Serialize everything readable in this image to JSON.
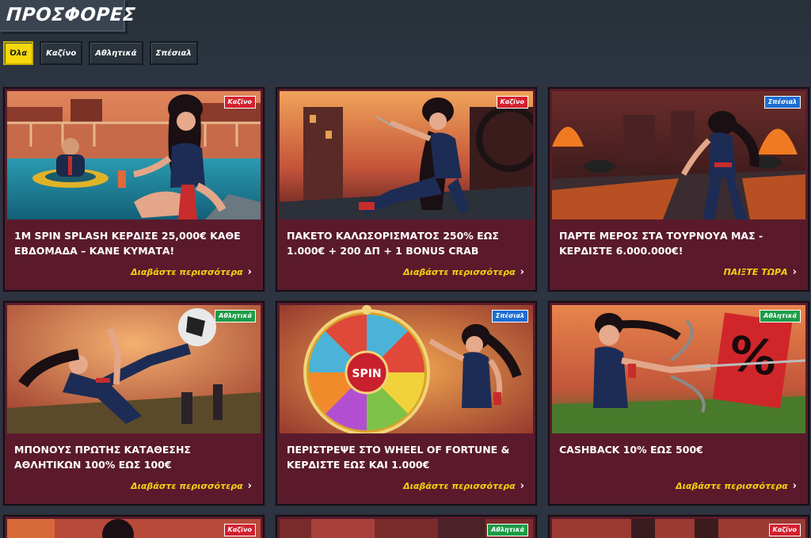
{
  "page": {
    "title": "ΠΡΟΣΦΟΡΕΣ"
  },
  "filters": [
    {
      "label": "Όλα",
      "active": true
    },
    {
      "label": "Καζίνο",
      "active": false
    },
    {
      "label": "Αθλητικά",
      "active": false
    },
    {
      "label": "Σπέσιαλ",
      "active": false
    }
  ],
  "cards": [
    {
      "badge": "Καζίνο",
      "badge_type": "casino",
      "title": "1M SPIN SPLASH ΚΕΡΔΙΣΕ 25,000€ ΚΑΘΕ ΕΒΔΟΜΑΔΑ – ΚΑΝΕ ΚΥΜΑΤΑ!",
      "cta": "Διαβάστε περισσότερα",
      "scene": "pool"
    },
    {
      "badge": "Καζίνο",
      "badge_type": "casino",
      "title": "ΠΑΚΕΤΟ ΚΑΛΩΣΟΡΙΣΜΑΤΟΣ 250% ΕΩΣ 1.000€ + 200 ΔΠ + 1 BONUS CRAB",
      "cta": "Διαβάστε περισσότερα",
      "scene": "roof"
    },
    {
      "badge": "Σπέσιαλ",
      "badge_type": "special",
      "title": "ΠΑΡΤΕ ΜΕΡΟΣ ΣΤΑ ΤΟΥΡΝΟΥΑ ΜΑΣ - ΚΕΡΔΙΣΤΕ 6.000.000€!",
      "cta": "ΠΑΙΞΤΕ ΤΩΡΑ",
      "scene": "fire"
    },
    {
      "badge": "Αθλητικά",
      "badge_type": "sports",
      "title": "ΜΠΟΝΟΥΣ ΠΡΩΤΗΣ ΚΑΤΑΘΕΣΗΣ ΑΘΛΗΤΙΚΩΝ 100% ΕΩΣ 100€",
      "cta": "Διαβάστε περισσότερα",
      "scene": "kick"
    },
    {
      "badge": "Σπέσιαλ",
      "badge_type": "special",
      "title": "ΠΕΡΙΣΤΡΕΨΕ ΣΤΟ WHEEL OF FORTUNE & ΚΕΡΔΙΣΤΕ ΕΩΣ ΚΑΙ 1.000€",
      "cta": "Διαβάστε περισσότερα",
      "scene": "wheel",
      "wheel_text": "SPIN"
    },
    {
      "badge": "Αθλητικά",
      "badge_type": "sports",
      "title": "CASHBACK 10% ΕΩΣ 500€",
      "cta": "Διαβάστε περισσότερα",
      "scene": "cashback",
      "sign_text": "%"
    },
    {
      "badge": "Καζίνο",
      "badge_type": "casino",
      "title": "",
      "cta": "",
      "scene": "partial1"
    },
    {
      "badge": "Αθλητικά",
      "badge_type": "sports",
      "title": "",
      "cta": "",
      "scene": "partial2"
    },
    {
      "badge": "Καζίνο",
      "badge_type": "casino",
      "title": "",
      "cta": "",
      "scene": "partial3"
    }
  ],
  "icons": {
    "cta_chevron": "chevron-right-icon"
  },
  "colors": {
    "accent_yellow": "#f6d80b",
    "card_bg": "#5a1a2c",
    "casino": "#d4202f",
    "special": "#1e6ed1",
    "sports": "#1c9c47"
  }
}
